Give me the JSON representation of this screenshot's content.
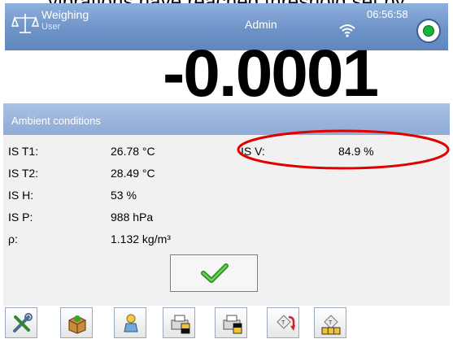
{
  "caption": "vibrations have reached threshold set by ",
  "header": {
    "app_name": "Weighing",
    "user_role": "User",
    "account": "Admin",
    "time": "06:56:58",
    "status_color": "#12b43a"
  },
  "display": {
    "reading": "-0.0001"
  },
  "dialog": {
    "title": "Ambient conditions",
    "rows": [
      {
        "label": "IS T1:",
        "value": "26.78 °C"
      },
      {
        "label": "IS T2:",
        "value": "28.49 °C"
      },
      {
        "label": "IS H:",
        "value": "53 %"
      },
      {
        "label": "IS P:",
        "value": "988 hPa"
      },
      {
        "label": "ρ:",
        "value": "1.132 kg/m³"
      }
    ],
    "extra": {
      "label": "IS V:",
      "value": "84.9 %"
    },
    "ok_icon": "checkmark-icon"
  },
  "toolbar": {
    "icons": [
      "tools-icon",
      "box-icon",
      "weight-icon",
      "printer-icon",
      "printer-header-icon",
      "tare-back-icon",
      "tare-keypad-icon"
    ]
  },
  "colors": {
    "header_bg": "#6e93c7",
    "dialog_header_bg": "#8eabd6",
    "annotation": "#e00000",
    "ok_check": "#3aa52b"
  }
}
